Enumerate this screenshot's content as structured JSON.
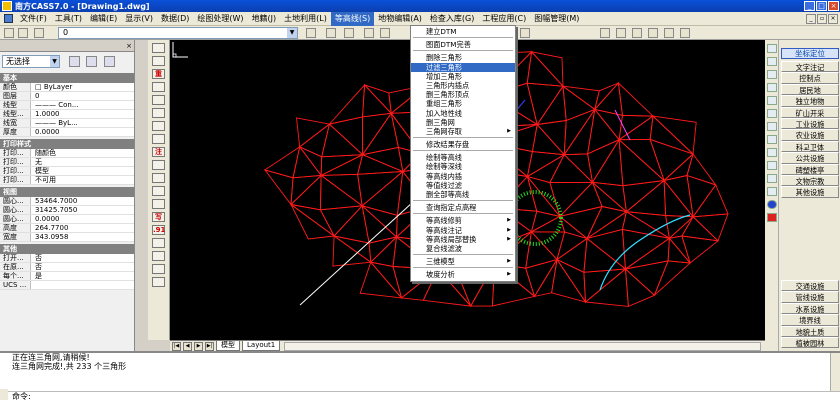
{
  "window": {
    "title": "南方CASS7.0 - [Drawing1.dwg]"
  },
  "menubar": {
    "items": [
      {
        "label": "文件(F)"
      },
      {
        "label": "工具(T)"
      },
      {
        "label": "编辑(E)"
      },
      {
        "label": "显示(V)"
      },
      {
        "label": "数据(D)"
      },
      {
        "label": "绘图处理(W)"
      },
      {
        "label": "地籍(J)"
      },
      {
        "label": "土地利用(L)"
      },
      {
        "label": "等高线(S)"
      },
      {
        "label": "地物编辑(A)"
      },
      {
        "label": "检查入库(G)"
      },
      {
        "label": "工程应用(C)"
      },
      {
        "label": "图幅管理(M)"
      }
    ],
    "active_index": 8
  },
  "toolbar": {
    "layer_value": "0"
  },
  "properties": {
    "select_value": "无选择",
    "groups": [
      {
        "title": "基本",
        "rows": [
          {
            "k": "颜色",
            "v": "□ ByLayer"
          },
          {
            "k": "图层",
            "v": "0"
          },
          {
            "k": "线型",
            "v": "——— Con..."
          },
          {
            "k": "线型...",
            "v": "1.0000"
          },
          {
            "k": "线宽",
            "v": "——— ByL..."
          },
          {
            "k": "厚度",
            "v": "0.0000"
          }
        ]
      },
      {
        "title": "打印样式",
        "rows": [
          {
            "k": "打印...",
            "v": "随颜色"
          },
          {
            "k": "打印...",
            "v": "无"
          },
          {
            "k": "打印...",
            "v": "模型"
          },
          {
            "k": "打印...",
            "v": "不可用"
          }
        ]
      },
      {
        "title": "视图",
        "rows": [
          {
            "k": "圆心...",
            "v": "53464.7000"
          },
          {
            "k": "圆心...",
            "v": "31425.7050"
          },
          {
            "k": "圆心...",
            "v": "0.0000"
          },
          {
            "k": "高度",
            "v": "264.7700"
          },
          {
            "k": "宽度",
            "v": "343.0958"
          }
        ]
      },
      {
        "title": "其他",
        "rows": [
          {
            "k": "打开...",
            "v": "否"
          },
          {
            "k": "在原...",
            "v": "否"
          },
          {
            "k": "每个...",
            "v": "是"
          },
          {
            "k": "UCS ...",
            "v": ""
          }
        ]
      }
    ]
  },
  "drawbar": {
    "labels": [
      "",
      "",
      "重",
      "",
      "",
      "",
      "",
      "",
      "注",
      "",
      "",
      "",
      "",
      "写",
      ".91",
      "",
      "",
      "",
      ""
    ]
  },
  "dropdown": {
    "items": [
      {
        "label": "建立DTM"
      },
      {
        "sep": true
      },
      {
        "label": "图面DTM完善"
      },
      {
        "sep": true
      },
      {
        "label": "删除三角形"
      },
      {
        "label": "过滤三角形",
        "hl": true
      },
      {
        "label": "增加三角形"
      },
      {
        "label": "三角形内插点"
      },
      {
        "label": "删三角形顶点"
      },
      {
        "label": "重组三角形"
      },
      {
        "label": "加入地性线"
      },
      {
        "label": "删三角网"
      },
      {
        "label": "三角网存取",
        "sub": true
      },
      {
        "sep": true
      },
      {
        "label": "修改结果存盘"
      },
      {
        "sep": true
      },
      {
        "label": "绘制等高线"
      },
      {
        "label": "绘制等深线"
      },
      {
        "label": "等高线内插"
      },
      {
        "label": "等值线过滤"
      },
      {
        "label": "删全部等高线"
      },
      {
        "sep": true
      },
      {
        "label": "查询指定点高程"
      },
      {
        "sep": true
      },
      {
        "label": "等高线修剪",
        "sub": true
      },
      {
        "label": "等高线注记",
        "sub": true
      },
      {
        "label": "等高线局部替换",
        "sub": true
      },
      {
        "label": "复合线滤波"
      },
      {
        "sep": true
      },
      {
        "label": "三维模型",
        "sub": true
      },
      {
        "sep": true
      },
      {
        "label": "坡度分析",
        "sub": true
      }
    ]
  },
  "rightpanel": {
    "title": "坐标定位",
    "top_items": [
      "文字注记",
      "控制点",
      "居民地",
      "独立地物",
      "矿山开采",
      "工业设施",
      "农业设施",
      "科교卫体",
      "公共设施",
      "碑塑楼亭",
      "文物宗教",
      "其他设施"
    ],
    "bottom_items": [
      "交通设施",
      "管线设施",
      "水系设施",
      "境界线",
      "地貌土质",
      "植被园林"
    ]
  },
  "layout_tabs": [
    "模型",
    "Layout1"
  ],
  "command": {
    "lines": [
      "正在连三角网,请稍候!",
      "连三角网完成!,共 233 个三角形"
    ],
    "prompt": "命令:"
  }
}
